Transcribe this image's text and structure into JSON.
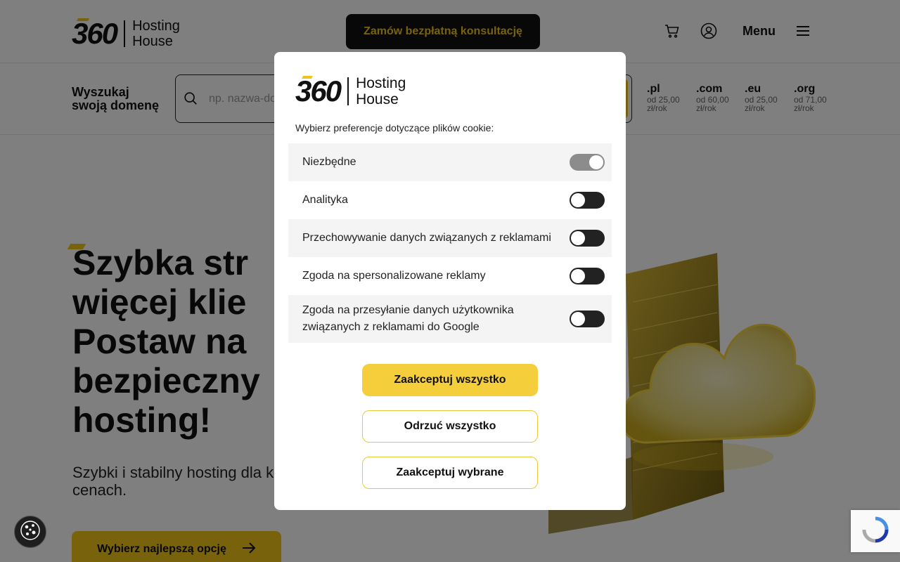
{
  "header": {
    "logo_number": "360",
    "logo_line1": "Hosting",
    "logo_line2": "House",
    "cta_label": "Zamów bezpłatną konsultację",
    "menu_label": "Menu"
  },
  "domain_search": {
    "label_line1": "Wyszukaj",
    "label_line2": "swoją domenę",
    "placeholder": "np. nazwa-domeny.pl",
    "tlds": [
      {
        "name": ".pl",
        "price": "od 25,00 zł/rok"
      },
      {
        "name": ".com",
        "price": "od 60,00 zł/rok"
      },
      {
        "name": ".eu",
        "price": "od 25,00 zł/rok"
      },
      {
        "name": ".org",
        "price": "od 71,00 zł/rok"
      }
    ]
  },
  "hero": {
    "title_lines": [
      "Szybka str",
      "więcej klie",
      "Postaw na",
      "bezpieczny",
      "hosting!"
    ],
    "subtitle": "Szybki i stabilny hosting dla korzystnych cenach.",
    "button_label": "Wybierz najlepszą opcję"
  },
  "cookie_modal": {
    "logo_number": "360",
    "logo_line1": "Hosting",
    "logo_line2": "House",
    "description": "Wybierz preferencje dotyczące plików cookie:",
    "preferences": [
      {
        "label": "Niezbędne",
        "enabled": true,
        "locked": true
      },
      {
        "label": "Analityka",
        "enabled": false
      },
      {
        "label": "Przechowywanie danych związanych z reklamami",
        "enabled": false
      },
      {
        "label": "Zgoda na spersonalizowane reklamy",
        "enabled": false
      },
      {
        "label": "Zgoda na przesyłanie danych użytkownika związanych z reklamami do Google",
        "enabled": false
      }
    ],
    "accept_all": "Zaakceptuj wszystko",
    "reject_all": "Odrzuć wszystko",
    "accept_selected": "Zaakceptuj wybrane"
  },
  "colors": {
    "accent": "#f0c419",
    "dark": "#111111",
    "overlay": "rgba(0,0,0,0.5)"
  },
  "icons": [
    "cart-icon",
    "user-icon",
    "hamburger-menu-icon",
    "search-icon",
    "arrow-right-icon",
    "cookie-icon",
    "recaptcha-icon"
  ]
}
